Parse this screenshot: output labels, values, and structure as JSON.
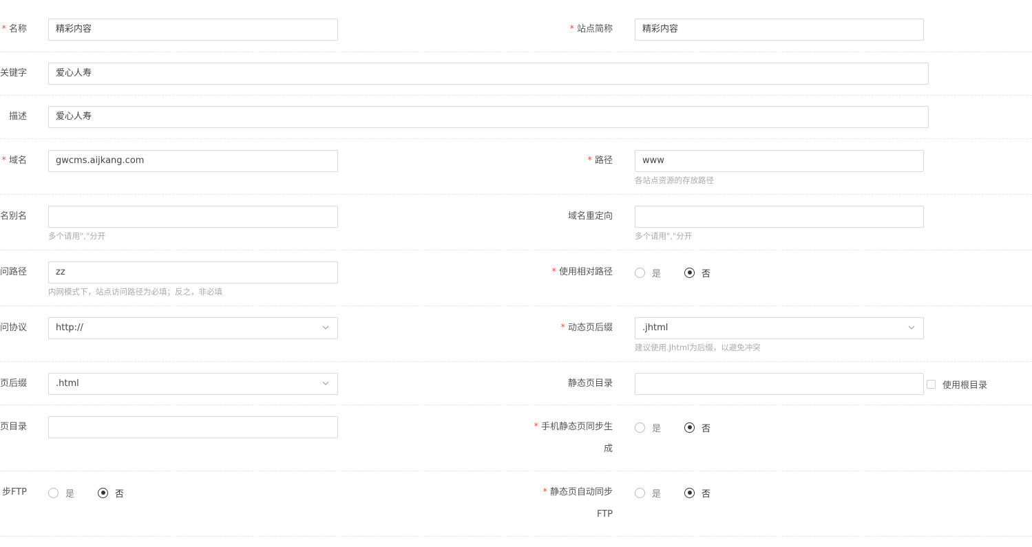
{
  "form": {
    "name": {
      "label": "名称",
      "value": "精彩内容"
    },
    "short_name": {
      "label": "站点简称",
      "value": "精彩内容"
    },
    "keywords": {
      "label": "关键字",
      "value": "爱心人寿"
    },
    "description": {
      "label": "描述",
      "value": "爱心人寿"
    },
    "domain": {
      "label": "域名",
      "value": "gwcms.aijkang.com"
    },
    "path": {
      "label": "路径",
      "value": "www",
      "hint": "各站点资源的存放路径"
    },
    "domain_alias": {
      "label": "名别名",
      "value": "",
      "hint": "多个请用\",\"分开"
    },
    "domain_redirect": {
      "label": "域名重定向",
      "value": "",
      "hint": "多个请用\",\"分开"
    },
    "access_path": {
      "label": "问路径",
      "value": "zz",
      "hint": "内网模式下，站点访问路径为必填；反之，非必填"
    },
    "relative_path": {
      "label": "使用相对路径",
      "options": [
        "是",
        "否"
      ],
      "selected": "否"
    },
    "access_protocol": {
      "label": "问协议",
      "value": "http://"
    },
    "dynamic_suffix": {
      "label": "动态页后缀",
      "value": ".jhtml",
      "hint": "建议使用.Jhtml为后缀，以避免冲突"
    },
    "static_suffix": {
      "label": "页后缀",
      "value": ".html"
    },
    "static_dir": {
      "label": "静态页目录",
      "value": "",
      "checkbox_label": "使用根目录"
    },
    "mobile_static_dir": {
      "label": "页目录",
      "value": ""
    },
    "mobile_static_sync": {
      "label_line1": "手机静态页同步生",
      "label_line2": "成",
      "options": [
        "是",
        "否"
      ],
      "selected": "否"
    },
    "sync_ftp": {
      "label": "步FTP",
      "options": [
        "是",
        "否"
      ],
      "selected": "否"
    },
    "static_auto_ftp": {
      "label_line1": "静态页自动同步",
      "label_line2": "FTP",
      "options": [
        "是",
        "否"
      ],
      "selected": "否"
    }
  },
  "colors": {
    "required_star": "#f5503a",
    "border": "#d9d9d9",
    "hint": "#aaaaaa"
  }
}
